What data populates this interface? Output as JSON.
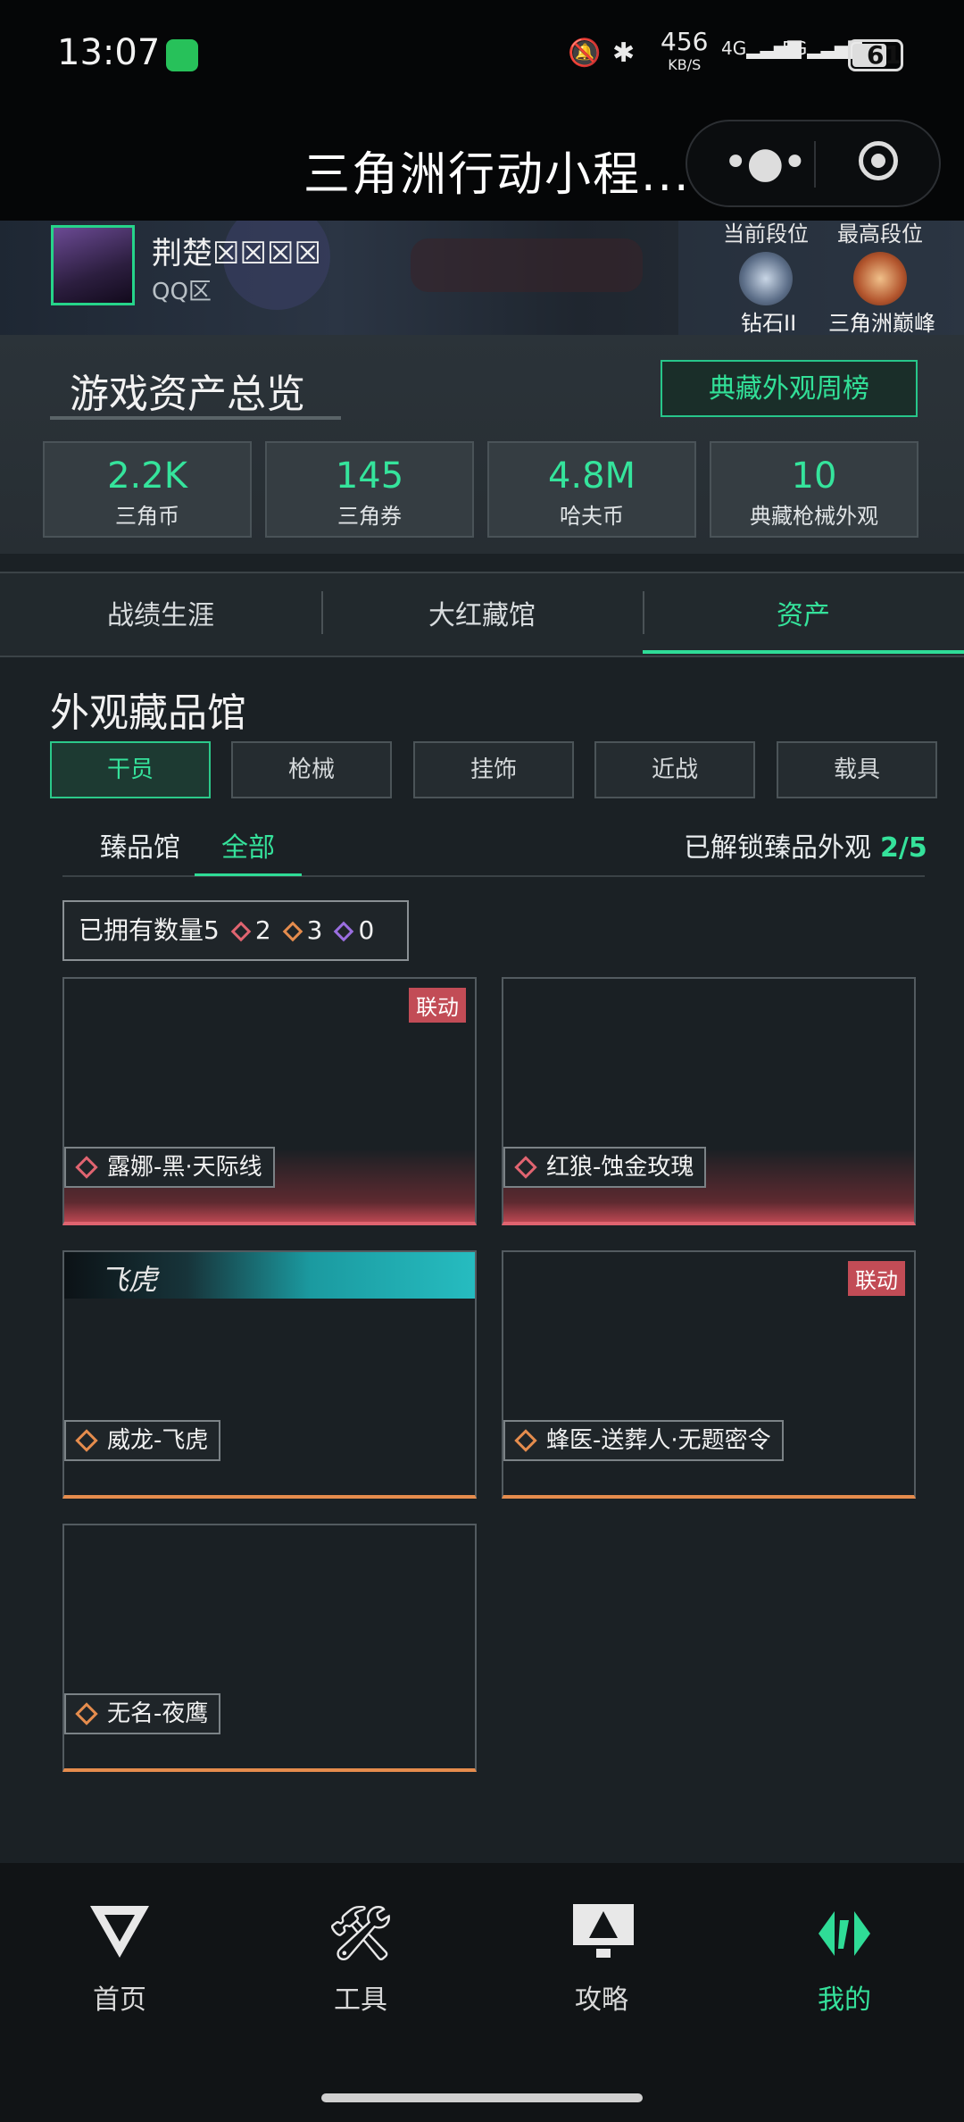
{
  "status_bar": {
    "time": "13:07",
    "speed": "456",
    "speed_unit": "KB/S",
    "net1": "4G",
    "net2": "5G",
    "battery": "61"
  },
  "title_bar": {
    "title": "三角洲行动小程..."
  },
  "profile": {
    "name": "荆楚☒☒☒☒",
    "zone": "QQ区",
    "current_rank_header": "当前段位",
    "current_rank": "钻石II",
    "highest_rank_header": "最高段位",
    "highest_rank": "三角洲巅峰"
  },
  "overview": {
    "title": "游戏资产总览",
    "ranking_button": "典藏外观周榜",
    "stats": [
      {
        "value": "2.2K",
        "label": "三角币"
      },
      {
        "value": "145",
        "label": "三角券"
      },
      {
        "value": "4.8M",
        "label": "哈夫币"
      },
      {
        "value": "10",
        "label": "典藏枪械外观"
      }
    ]
  },
  "tabs": [
    "战绩生涯",
    "大红藏馆",
    "资产"
  ],
  "collection": {
    "title": "外观藏品馆",
    "categories": [
      "干员",
      "枪械",
      "挂饰",
      "近战",
      "载具"
    ],
    "subtabs": [
      "臻品馆",
      "全部"
    ],
    "unlocked_label": "已解锁臻品外观",
    "unlocked_value": "2/5",
    "count_label": "已拥有数量5",
    "count_red": "2",
    "count_orange": "3",
    "count_purple": "0",
    "cards": [
      {
        "name": "露娜-黑·天际线",
        "tag": "联动"
      },
      {
        "name": "红狼-蚀金玫瑰"
      },
      {
        "name": "威龙-飞虎",
        "banner_text": "飞虎"
      },
      {
        "name": "蜂医-送葬人·无题密令",
        "tag": "联动"
      },
      {
        "name": "无名-夜鹰"
      }
    ]
  },
  "bottom_nav": [
    "首页",
    "工具",
    "攻略",
    "我的"
  ],
  "colors": {
    "accent": "#2fdc97",
    "red_rarity": "#e06470",
    "orange_rarity": "#e58c4d",
    "purple_rarity": "#9a6ee0"
  }
}
